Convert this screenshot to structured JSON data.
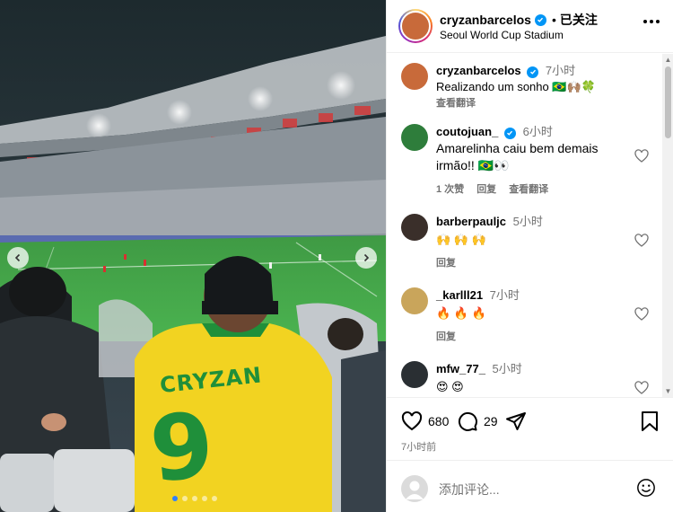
{
  "post": {
    "username": "cryzanbarcelos",
    "separator": "•",
    "follow_label": "已关注",
    "location": "Seoul World Cup Stadium",
    "jersey_name": "CRYZAN",
    "jersey_number": "9",
    "carousel_dots": 5,
    "active_dot": 0
  },
  "comments": [
    {
      "username": "cryzanbarcelos",
      "verified": true,
      "time": "7小时",
      "text": "Realizando um sonho 🇧🇷🙌🏽🍀",
      "meta": [
        "查看翻译"
      ],
      "like_icon": false
    },
    {
      "username": "coutojuan_",
      "verified": true,
      "time": "6小时",
      "text": "Amarelinha caiu bem demais irmão!! 🇧🇷👀",
      "meta": [
        "1 次赞",
        "回复",
        "查看翻译"
      ],
      "like_icon": true
    },
    {
      "username": "barberpauljc",
      "verified": false,
      "time": "5小时",
      "text": "🙌 🙌 🙌",
      "meta": [
        "回复"
      ],
      "like_icon": true
    },
    {
      "username": "_karlll21",
      "verified": false,
      "time": "7小时",
      "text": "🔥 🔥 🔥",
      "meta": [
        "回复"
      ],
      "like_icon": true
    },
    {
      "username": "mfw_77_",
      "verified": false,
      "time": "5小时",
      "text": "😍 😍",
      "meta": [],
      "like_icon": true
    }
  ],
  "actions": {
    "likes": "680",
    "comments": "29",
    "post_time": "7小时前"
  },
  "add_comment": {
    "placeholder": "添加评论..."
  },
  "colors": {
    "verified": "#0095f6",
    "secondary_text": "#737373",
    "jersey_yellow": "#f2d321",
    "jersey_green": "#1f8f3a",
    "pitch_green": "#3fa34a"
  },
  "icons": [
    "more-options-icon",
    "verified-badge-icon",
    "heart-icon",
    "comment-icon",
    "share-icon",
    "bookmark-icon",
    "emoji-icon",
    "chevron-left-icon",
    "chevron-right-icon"
  ]
}
